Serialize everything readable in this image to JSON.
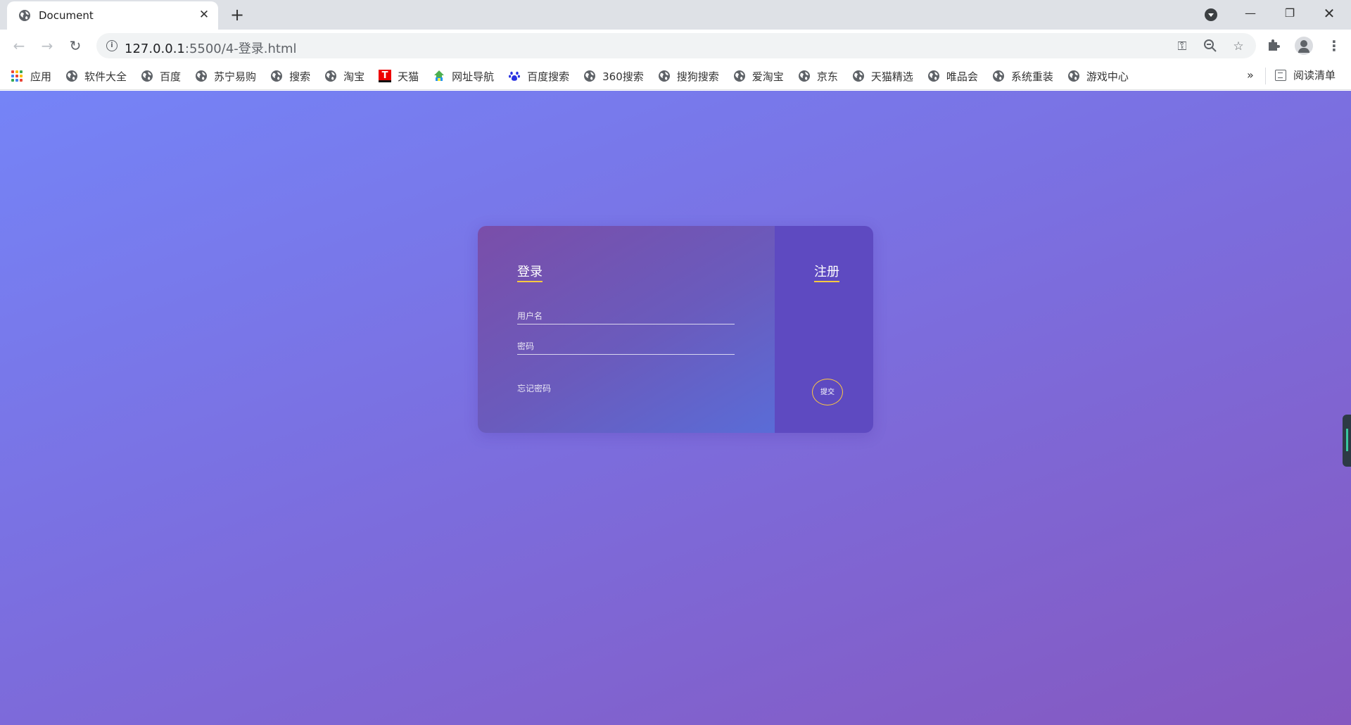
{
  "browser": {
    "tab": {
      "title": "Document",
      "close": "✕"
    },
    "new_tab": "+",
    "window": {
      "minimize": "—",
      "maximize": "❐",
      "close": "✕"
    },
    "nav": {
      "back": "←",
      "forward": "→",
      "reload": "↻"
    },
    "url": {
      "host": "127.0.0.1",
      "path": ":5500/4-登录.html"
    },
    "bookmarks": [
      {
        "label": "应用",
        "icon": "apps-icon"
      },
      {
        "label": "软件大全",
        "icon": "globe-icon"
      },
      {
        "label": "百度",
        "icon": "globe-icon"
      },
      {
        "label": "苏宁易购",
        "icon": "globe-icon"
      },
      {
        "label": "搜索",
        "icon": "globe-icon"
      },
      {
        "label": "淘宝",
        "icon": "globe-icon"
      },
      {
        "label": "天猫",
        "icon": "tmall-icon"
      },
      {
        "label": "网址导航",
        "icon": "hao123-icon"
      },
      {
        "label": "百度搜索",
        "icon": "baidu-paw-icon"
      },
      {
        "label": "360搜索",
        "icon": "globe-icon"
      },
      {
        "label": "搜狗搜索",
        "icon": "globe-icon"
      },
      {
        "label": "爱淘宝",
        "icon": "globe-icon"
      },
      {
        "label": "京东",
        "icon": "globe-icon"
      },
      {
        "label": "天猫精选",
        "icon": "globe-icon"
      },
      {
        "label": "唯品会",
        "icon": "globe-icon"
      },
      {
        "label": "系统重装",
        "icon": "globe-icon"
      },
      {
        "label": "游戏中心",
        "icon": "globe-icon"
      }
    ],
    "bookmarks_more": "»",
    "reading_list": "阅读清单"
  },
  "page": {
    "login_title": "登录",
    "register_title": "注册",
    "username_placeholder": "用户名",
    "password_placeholder": "密码",
    "forgot_password": "忘记密码",
    "submit_label": "提交",
    "colors": {
      "accent": "#ffc940",
      "panel_right": "#5e4ac1"
    }
  }
}
